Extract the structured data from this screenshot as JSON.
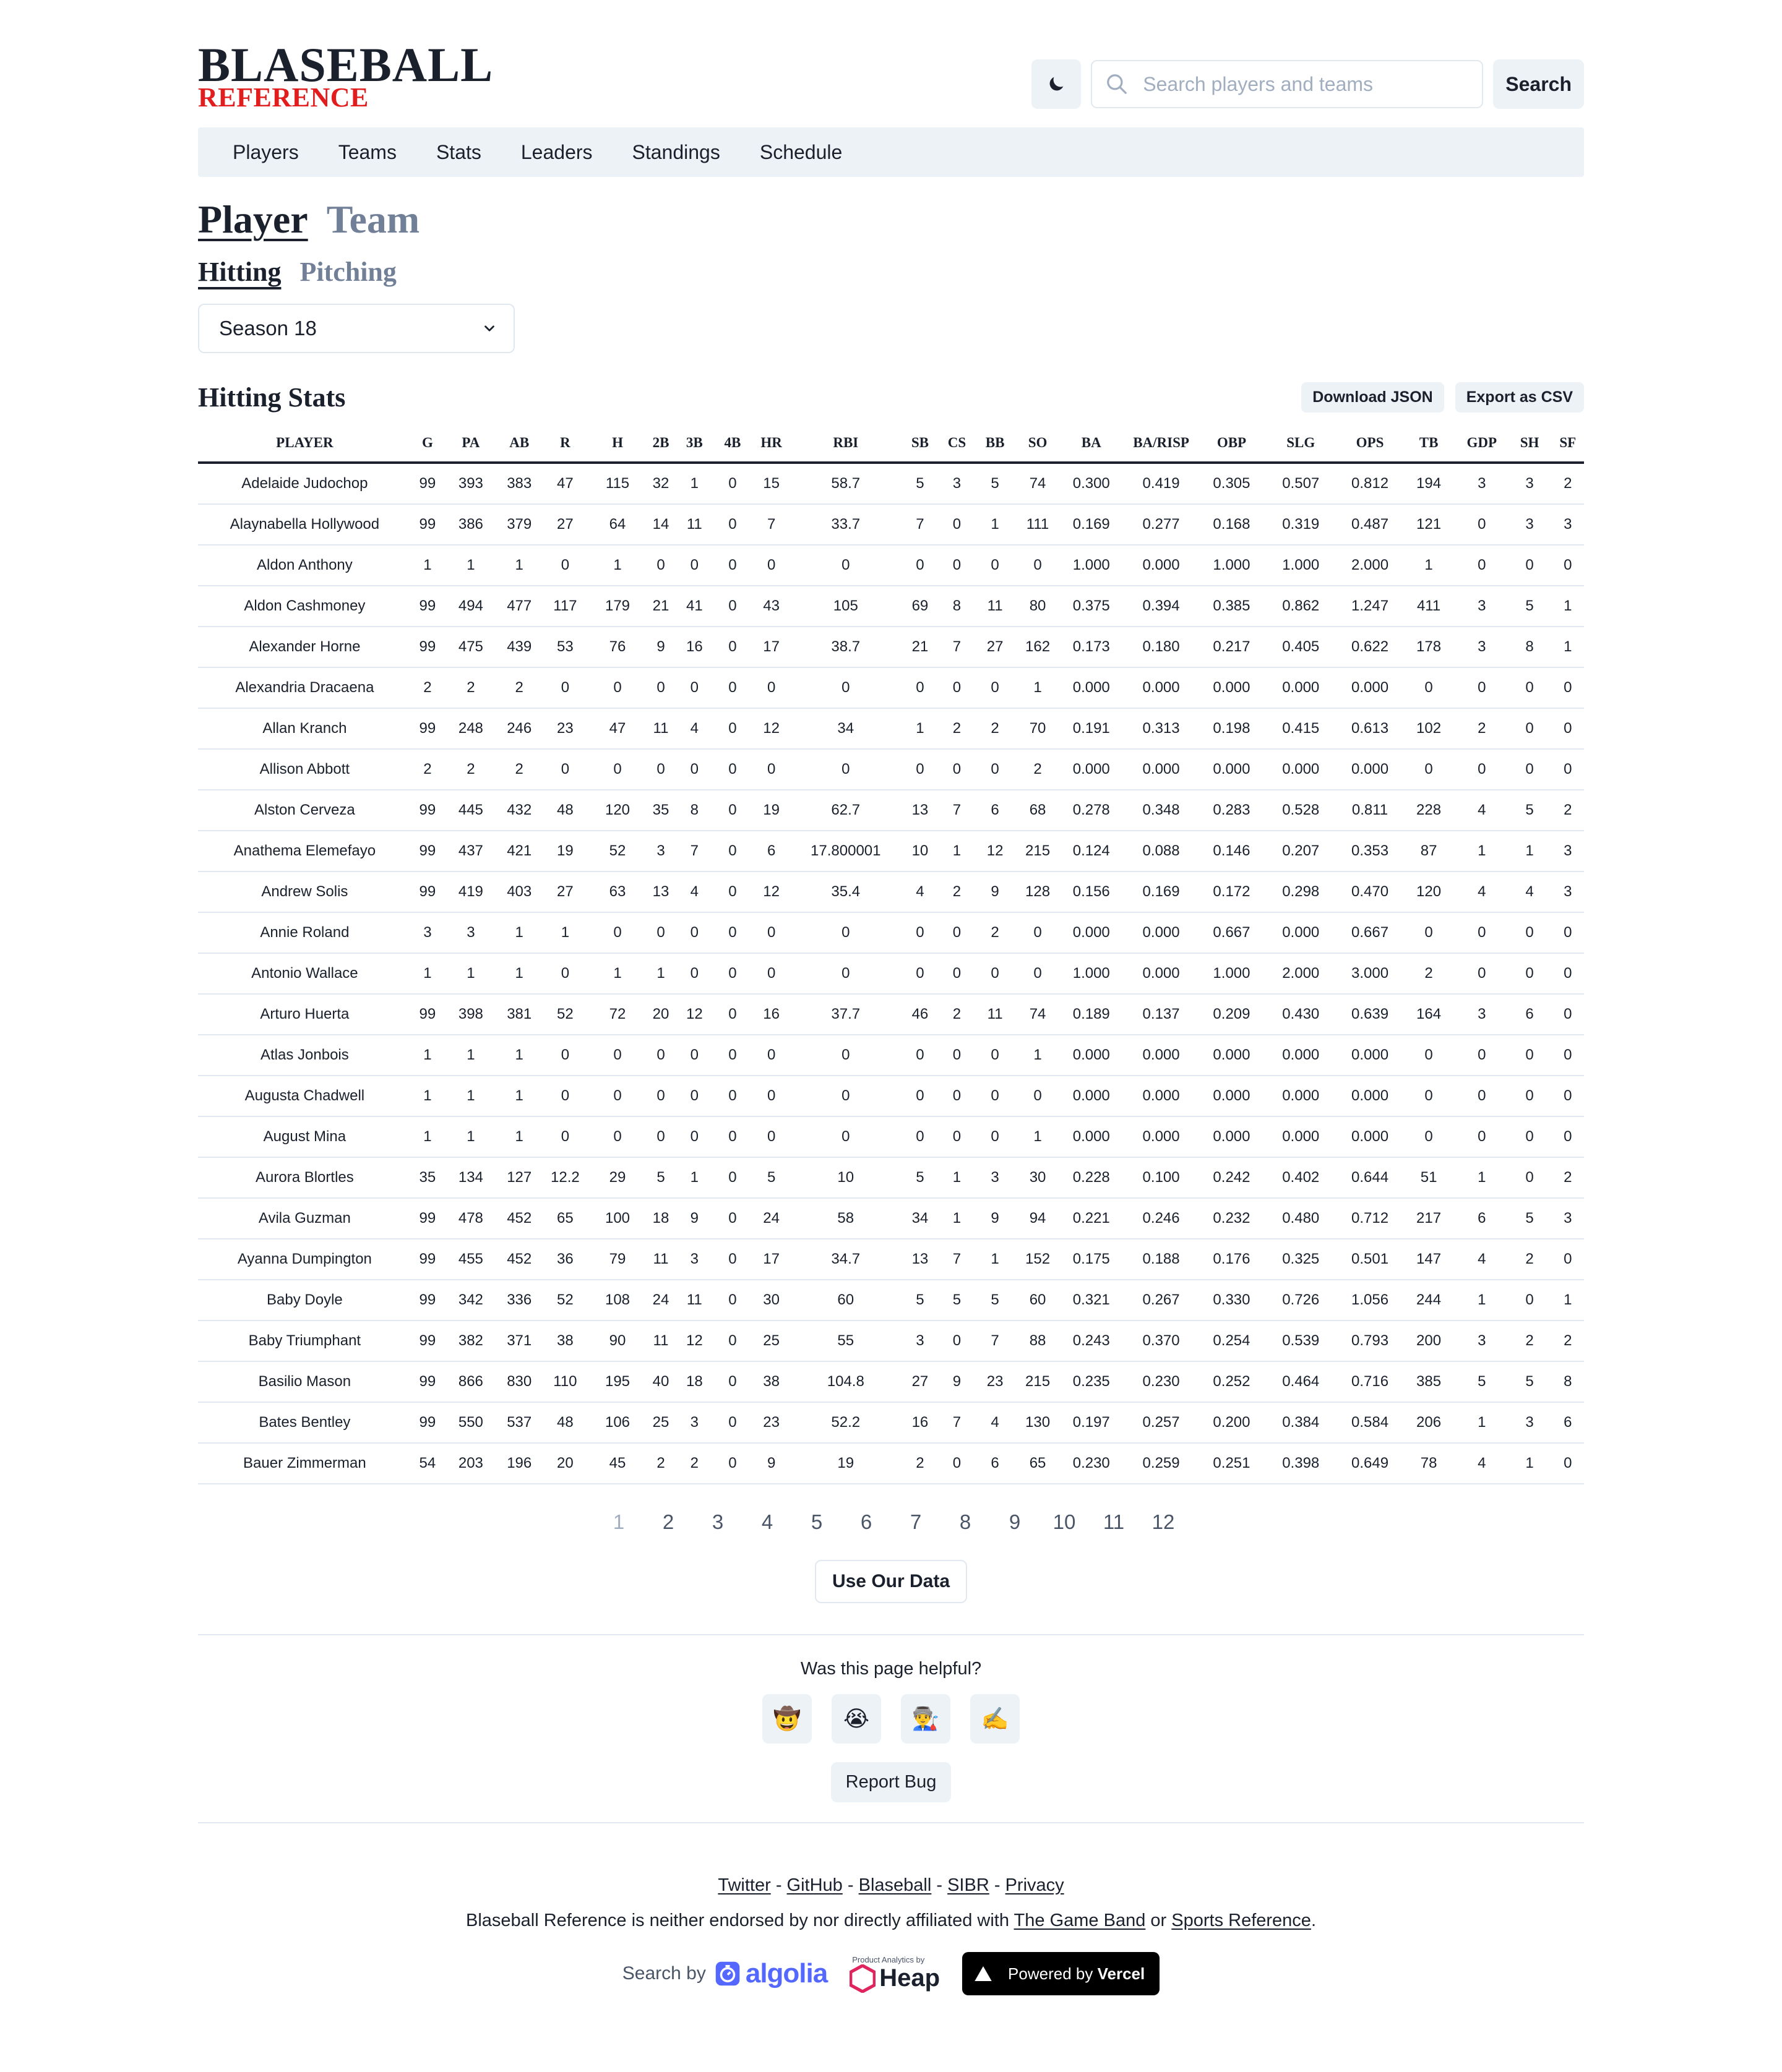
{
  "logo": {
    "main": "BLASEBALL",
    "sub": "REFERENCE"
  },
  "search": {
    "placeholder": "Search players and teams",
    "value": "",
    "button": "Search"
  },
  "nav": [
    "Players",
    "Teams",
    "Stats",
    "Leaders",
    "Standings",
    "Schedule"
  ],
  "toggles": {
    "entity": {
      "active": "Player",
      "inactive": "Team"
    },
    "mode": {
      "active": "Hitting",
      "inactive": "Pitching"
    }
  },
  "season": {
    "selected": "Season 18"
  },
  "stats": {
    "title": "Hitting Stats",
    "download_label": "Download JSON",
    "export_label": "Export as CSV",
    "columns": [
      "PLAYER",
      "G",
      "PA",
      "AB",
      "R",
      "H",
      "2B",
      "3B",
      "4B",
      "HR",
      "RBI",
      "SB",
      "CS",
      "BB",
      "SO",
      "BA",
      "BA/RISP",
      "OBP",
      "SLG",
      "OPS",
      "TB",
      "GDP",
      "SH",
      "SF"
    ],
    "rows": [
      [
        "Adelaide Judochop",
        "99",
        "393",
        "383",
        "47",
        "115",
        "32",
        "1",
        "0",
        "15",
        "58.7",
        "5",
        "3",
        "5",
        "74",
        "0.300",
        "0.419",
        "0.305",
        "0.507",
        "0.812",
        "194",
        "3",
        "3",
        "2"
      ],
      [
        "Alaynabella Hollywood",
        "99",
        "386",
        "379",
        "27",
        "64",
        "14",
        "11",
        "0",
        "7",
        "33.7",
        "7",
        "0",
        "1",
        "111",
        "0.169",
        "0.277",
        "0.168",
        "0.319",
        "0.487",
        "121",
        "0",
        "3",
        "3"
      ],
      [
        "Aldon Anthony",
        "1",
        "1",
        "1",
        "0",
        "1",
        "0",
        "0",
        "0",
        "0",
        "0",
        "0",
        "0",
        "0",
        "0",
        "1.000",
        "0.000",
        "1.000",
        "1.000",
        "2.000",
        "1",
        "0",
        "0",
        "0"
      ],
      [
        "Aldon Cashmoney",
        "99",
        "494",
        "477",
        "117",
        "179",
        "21",
        "41",
        "0",
        "43",
        "105",
        "69",
        "8",
        "11",
        "80",
        "0.375",
        "0.394",
        "0.385",
        "0.862",
        "1.247",
        "411",
        "3",
        "5",
        "1"
      ],
      [
        "Alexander Horne",
        "99",
        "475",
        "439",
        "53",
        "76",
        "9",
        "16",
        "0",
        "17",
        "38.7",
        "21",
        "7",
        "27",
        "162",
        "0.173",
        "0.180",
        "0.217",
        "0.405",
        "0.622",
        "178",
        "3",
        "8",
        "1"
      ],
      [
        "Alexandria Dracaena",
        "2",
        "2",
        "2",
        "0",
        "0",
        "0",
        "0",
        "0",
        "0",
        "0",
        "0",
        "0",
        "0",
        "1",
        "0.000",
        "0.000",
        "0.000",
        "0.000",
        "0.000",
        "0",
        "0",
        "0",
        "0"
      ],
      [
        "Allan Kranch",
        "99",
        "248",
        "246",
        "23",
        "47",
        "11",
        "4",
        "0",
        "12",
        "34",
        "1",
        "2",
        "2",
        "70",
        "0.191",
        "0.313",
        "0.198",
        "0.415",
        "0.613",
        "102",
        "2",
        "0",
        "0"
      ],
      [
        "Allison Abbott",
        "2",
        "2",
        "2",
        "0",
        "0",
        "0",
        "0",
        "0",
        "0",
        "0",
        "0",
        "0",
        "0",
        "2",
        "0.000",
        "0.000",
        "0.000",
        "0.000",
        "0.000",
        "0",
        "0",
        "0",
        "0"
      ],
      [
        "Alston Cerveza",
        "99",
        "445",
        "432",
        "48",
        "120",
        "35",
        "8",
        "0",
        "19",
        "62.7",
        "13",
        "7",
        "6",
        "68",
        "0.278",
        "0.348",
        "0.283",
        "0.528",
        "0.811",
        "228",
        "4",
        "5",
        "2"
      ],
      [
        "Anathema Elemefayo",
        "99",
        "437",
        "421",
        "19",
        "52",
        "3",
        "7",
        "0",
        "6",
        "17.800001",
        "10",
        "1",
        "12",
        "215",
        "0.124",
        "0.088",
        "0.146",
        "0.207",
        "0.353",
        "87",
        "1",
        "1",
        "3"
      ],
      [
        "Andrew Solis",
        "99",
        "419",
        "403",
        "27",
        "63",
        "13",
        "4",
        "0",
        "12",
        "35.4",
        "4",
        "2",
        "9",
        "128",
        "0.156",
        "0.169",
        "0.172",
        "0.298",
        "0.470",
        "120",
        "4",
        "4",
        "3"
      ],
      [
        "Annie Roland",
        "3",
        "3",
        "1",
        "1",
        "0",
        "0",
        "0",
        "0",
        "0",
        "0",
        "0",
        "0",
        "2",
        "0",
        "0.000",
        "0.000",
        "0.667",
        "0.000",
        "0.667",
        "0",
        "0",
        "0",
        "0"
      ],
      [
        "Antonio Wallace",
        "1",
        "1",
        "1",
        "0",
        "1",
        "1",
        "0",
        "0",
        "0",
        "0",
        "0",
        "0",
        "0",
        "0",
        "1.000",
        "0.000",
        "1.000",
        "2.000",
        "3.000",
        "2",
        "0",
        "0",
        "0"
      ],
      [
        "Arturo Huerta",
        "99",
        "398",
        "381",
        "52",
        "72",
        "20",
        "12",
        "0",
        "16",
        "37.7",
        "46",
        "2",
        "11",
        "74",
        "0.189",
        "0.137",
        "0.209",
        "0.430",
        "0.639",
        "164",
        "3",
        "6",
        "0"
      ],
      [
        "Atlas Jonbois",
        "1",
        "1",
        "1",
        "0",
        "0",
        "0",
        "0",
        "0",
        "0",
        "0",
        "0",
        "0",
        "0",
        "1",
        "0.000",
        "0.000",
        "0.000",
        "0.000",
        "0.000",
        "0",
        "0",
        "0",
        "0"
      ],
      [
        "Augusta Chadwell",
        "1",
        "1",
        "1",
        "0",
        "0",
        "0",
        "0",
        "0",
        "0",
        "0",
        "0",
        "0",
        "0",
        "0",
        "0.000",
        "0.000",
        "0.000",
        "0.000",
        "0.000",
        "0",
        "0",
        "0",
        "0"
      ],
      [
        "August Mina",
        "1",
        "1",
        "1",
        "0",
        "0",
        "0",
        "0",
        "0",
        "0",
        "0",
        "0",
        "0",
        "0",
        "1",
        "0.000",
        "0.000",
        "0.000",
        "0.000",
        "0.000",
        "0",
        "0",
        "0",
        "0"
      ],
      [
        "Aurora Blortles",
        "35",
        "134",
        "127",
        "12.2",
        "29",
        "5",
        "1",
        "0",
        "5",
        "10",
        "5",
        "1",
        "3",
        "30",
        "0.228",
        "0.100",
        "0.242",
        "0.402",
        "0.644",
        "51",
        "1",
        "0",
        "2"
      ],
      [
        "Avila Guzman",
        "99",
        "478",
        "452",
        "65",
        "100",
        "18",
        "9",
        "0",
        "24",
        "58",
        "34",
        "1",
        "9",
        "94",
        "0.221",
        "0.246",
        "0.232",
        "0.480",
        "0.712",
        "217",
        "6",
        "5",
        "3"
      ],
      [
        "Ayanna Dumpington",
        "99",
        "455",
        "452",
        "36",
        "79",
        "11",
        "3",
        "0",
        "17",
        "34.7",
        "13",
        "7",
        "1",
        "152",
        "0.175",
        "0.188",
        "0.176",
        "0.325",
        "0.501",
        "147",
        "4",
        "2",
        "0"
      ],
      [
        "Baby Doyle",
        "99",
        "342",
        "336",
        "52",
        "108",
        "24",
        "11",
        "0",
        "30",
        "60",
        "5",
        "5",
        "5",
        "60",
        "0.321",
        "0.267",
        "0.330",
        "0.726",
        "1.056",
        "244",
        "1",
        "0",
        "1"
      ],
      [
        "Baby Triumphant",
        "99",
        "382",
        "371",
        "38",
        "90",
        "11",
        "12",
        "0",
        "25",
        "55",
        "3",
        "0",
        "7",
        "88",
        "0.243",
        "0.370",
        "0.254",
        "0.539",
        "0.793",
        "200",
        "3",
        "2",
        "2"
      ],
      [
        "Basilio Mason",
        "99",
        "866",
        "830",
        "110",
        "195",
        "40",
        "18",
        "0",
        "38",
        "104.8",
        "27",
        "9",
        "23",
        "215",
        "0.235",
        "0.230",
        "0.252",
        "0.464",
        "0.716",
        "385",
        "5",
        "5",
        "8"
      ],
      [
        "Bates Bentley",
        "99",
        "550",
        "537",
        "48",
        "106",
        "25",
        "3",
        "0",
        "23",
        "52.2",
        "16",
        "7",
        "4",
        "130",
        "0.197",
        "0.257",
        "0.200",
        "0.384",
        "0.584",
        "206",
        "1",
        "3",
        "6"
      ],
      [
        "Bauer Zimmerman",
        "54",
        "203",
        "196",
        "20",
        "45",
        "2",
        "2",
        "0",
        "9",
        "19",
        "2",
        "0",
        "6",
        "65",
        "0.230",
        "0.259",
        "0.251",
        "0.398",
        "0.649",
        "78",
        "4",
        "1",
        "0"
      ]
    ]
  },
  "pagination": {
    "current": "1",
    "pages": [
      "1",
      "2",
      "3",
      "4",
      "5",
      "6",
      "7",
      "8",
      "9",
      "10",
      "11",
      "12"
    ]
  },
  "use_data_label": "Use Our Data",
  "feedback": {
    "question": "Was this page helpful?",
    "emojis": [
      "🤠",
      "😭",
      "👨‍🏭",
      "✍️"
    ],
    "report_label": "Report Bug"
  },
  "footer": {
    "links": [
      "Twitter",
      "GitHub",
      "Blaseball",
      "SIBR",
      "Privacy"
    ],
    "separator": "-",
    "disclaimer_pre": "Blaseball Reference is neither endorsed by nor directly affiliated with",
    "disclaimer_link1": "The Game Band",
    "disclaimer_mid": "or",
    "disclaimer_link2": "Sports Reference",
    "disclaimer_post": ".",
    "algolia_prefix": "Search by",
    "algolia_brand": "algolia",
    "heap_small": "Product Analytics by",
    "heap_brand": "Heap",
    "vercel_prefix": "Powered by",
    "vercel_brand": "Vercel"
  },
  "colors": {
    "accent_red": "#e11d1d",
    "nav_bg": "#edf2f7",
    "text": "#1a202c",
    "muted": "#718096",
    "algolia": "#5468ff",
    "heap": "#e0245e"
  }
}
